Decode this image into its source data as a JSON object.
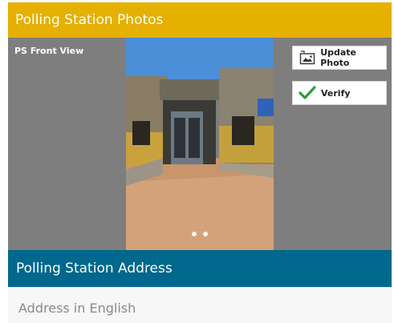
{
  "photos_section": {
    "title": "Polling Station Photos",
    "photo_label": "PS Front View",
    "update_photo_label": "Update Photo",
    "verify_label": "Verify",
    "carousel_dots": 2
  },
  "address_section": {
    "title": "Polling Station Address",
    "field_placeholder": "Address in English"
  },
  "colors": {
    "photos_header": "#e5b000",
    "address_header": "#00678d",
    "verify_check": "#2e9e3a"
  },
  "icons": {
    "update_photo": "image-edit-icon",
    "verify": "checkmark-icon"
  }
}
